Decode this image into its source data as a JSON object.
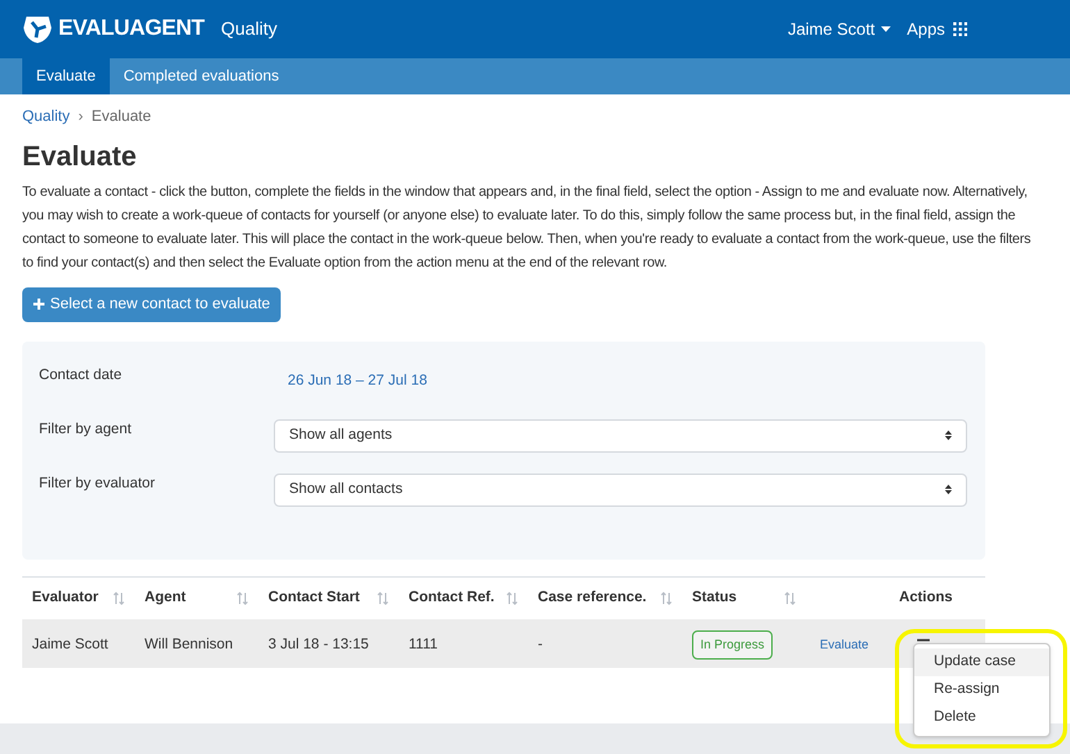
{
  "header": {
    "brand": "EVALUAGENT",
    "product": "Quality",
    "user": "Jaime Scott",
    "apps": "Apps"
  },
  "tabs": [
    {
      "label": "Evaluate",
      "selected": true
    },
    {
      "label": "Completed evaluations",
      "selected": false
    }
  ],
  "breadcrumb": [
    "Quality",
    "Evaluate"
  ],
  "breadcrumb_separator": "›",
  "title": "Evaluate",
  "intro": "To evaluate a contact - click the button, complete the fields in the window that appears and, in the final field, select the option - Assign to me and evaluate now. Alternatively, you may wish to create a work-queue of contacts for yourself (or anyone else) to evaluate later. To do this, simply follow the same process but, in the final field, assign the contact to someone to evaluate later. This will place the contact in the work-queue below. Then, when you're ready to evaluate a contact from the work-queue, use the filters to find your contact(s) and then select the Evaluate option from the action menu at the end of the relevant row.",
  "new_button": "Select a new contact to evaluate",
  "filters": [
    {
      "kind": "link",
      "label": "Contact date",
      "value": "26 Jun 18 – 27 Jul 18"
    },
    {
      "kind": "select",
      "label": "Filter by agent",
      "value": "Show all agents"
    },
    {
      "kind": "select",
      "label": "Filter by evaluator",
      "value": "Show all contacts"
    }
  ],
  "table": {
    "columns": [
      {
        "label": "Evaluator",
        "sortable": true
      },
      {
        "label": "Agent",
        "sortable": true
      },
      {
        "label": "Contact Start",
        "sortable": true
      },
      {
        "label": "Contact Ref.",
        "sortable": true
      },
      {
        "label": "Case reference.",
        "sortable": true
      },
      {
        "label": "Status",
        "sortable": true
      },
      {
        "label": "Actions",
        "sortable": false
      }
    ],
    "rows": [
      {
        "evaluator": "Jaime Scott",
        "agent": "Will Bennison",
        "contact_start": "3 Jul 18 - 13:15",
        "contact_ref": "1111",
        "case_reference": "-",
        "status": "In Progress",
        "action_link": "Evaluate"
      }
    ]
  },
  "action_menu": [
    {
      "label": "Update case",
      "selected": true
    },
    {
      "label": "Re-assign",
      "selected": false
    },
    {
      "label": "Delete",
      "selected": false
    }
  ]
}
